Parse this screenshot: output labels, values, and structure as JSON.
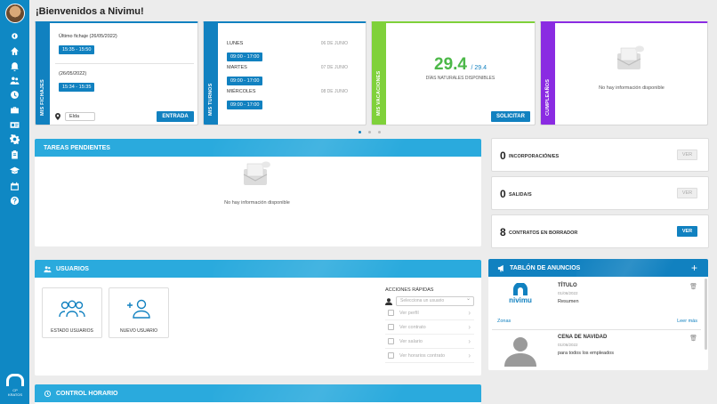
{
  "page": {
    "title": "¡Bienvenidos a Nivimu!"
  },
  "sidebar": {
    "brand_text": "CP KRATOS",
    "items": [
      "chevron-icon",
      "home-icon",
      "bell-icon",
      "users-icon",
      "clock-icon",
      "briefcase-icon",
      "id-card-icon",
      "settings-icon",
      "clipboard-icon",
      "graduation-icon",
      "calendar-icon",
      "help-icon"
    ]
  },
  "fichajes": {
    "strip_label": "MIS FICHAJES",
    "entries": [
      {
        "label": "Último fichaje (26/05/2022)",
        "time": "15:35 - 15:50"
      },
      {
        "label": "(26/05/2022)",
        "time": "15:34 - 15:35"
      }
    ],
    "location": "Elda",
    "button": "ENTRADA"
  },
  "turnos": {
    "strip_label": "MIS TURNOS",
    "items": [
      {
        "day": "LUNES",
        "date": "06 DE JUNIO",
        "time": "09:00 - 17:00"
      },
      {
        "day": "MARTES",
        "date": "07 DE JUNIO",
        "time": "09:00 - 17:00"
      },
      {
        "day": "MIÉRCOLES",
        "date": "08 DE JUNIO",
        "time": "09:00 - 17:00"
      }
    ]
  },
  "vacaciones": {
    "strip_label": "MIS VACACIONES",
    "available": "29.4",
    "total": "/ 29.4",
    "label": "DÍAS NATURALES DISPONIBLES",
    "button": "SOLICITAR"
  },
  "cumpleanos": {
    "strip_label": "CUMPLEAÑOS",
    "empty_text": "No hay información disponible"
  },
  "tareas": {
    "title": "TAREAS PENDIENTES",
    "empty_text": "No hay información disponible"
  },
  "counters": [
    {
      "num": "0",
      "label": "INCORPORACIÓN/ES",
      "button": "VER",
      "active": false
    },
    {
      "num": "0",
      "label": "SALIDA/S",
      "button": "VER",
      "active": false
    },
    {
      "num": "8",
      "label": "CONTRATOS EN BORRADOR",
      "button": "VER",
      "active": true
    }
  ],
  "usuarios": {
    "title": "USUARIOS",
    "tiles": [
      "ESTADO USUARIOS",
      "NUEVO USUARIO"
    ],
    "quick": {
      "title": "ACCIONES RÁPIDAS",
      "select_placeholder": "Selecciona un usuario",
      "actions": [
        "Ver perfil",
        "Ver contrato",
        "Ver salario",
        "Ver horarios contrato"
      ]
    }
  },
  "anuncios": {
    "title": "TABLÓN DE ANUNCIOS",
    "items": [
      {
        "title": "TÍTULO",
        "date": "01/06/2022",
        "body": "Resumen",
        "zone": "Zonas",
        "more": "Leer más"
      },
      {
        "title": "CENA DE NAVIDAD",
        "date": "01/06/2022",
        "body": "para todos los empleados"
      }
    ]
  },
  "control": {
    "title": "CONTROL HORARIO"
  }
}
